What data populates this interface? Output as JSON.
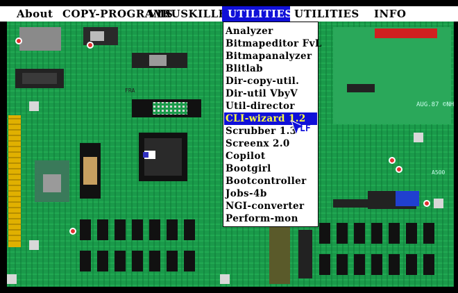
{
  "menubar": {
    "items": [
      {
        "label": "About"
      },
      {
        "label": "COPY-PROGRAMS"
      },
      {
        "label": "VIRUSKILLERS"
      },
      {
        "label": "UTILITIES"
      },
      {
        "label": "UTILITIES"
      },
      {
        "label": "INFO"
      }
    ],
    "active_index": 3
  },
  "dropdown": {
    "items": [
      {
        "label": "Analyzer"
      },
      {
        "label": "Bitmapeditor FvL"
      },
      {
        "label": "Bitmapanalyzer"
      },
      {
        "label": "Blitlab"
      },
      {
        "label": "Dir-copy-util."
      },
      {
        "label": "Dir-util VbyV"
      },
      {
        "label": "Util-director"
      },
      {
        "label": "CLI-wizard 1.2"
      },
      {
        "label": "Scrubber 1.3"
      },
      {
        "label": "Screenx 2.0"
      },
      {
        "label": "Copilot"
      },
      {
        "label": "Bootgirl"
      },
      {
        "label": "Bootcontroller"
      },
      {
        "label": "Jobs-4b"
      },
      {
        "label": "NGI-converter"
      },
      {
        "label": "Perform-mon"
      }
    ],
    "selected_index": 7
  },
  "board_labels": {
    "copyright_block": "AUG.87 ©NH",
    "board_model": "A500",
    "cursor_label": "LF",
    "chip_label": "FRA"
  },
  "colors": {
    "board": "#1a9a4a",
    "menubar": "#ffffff",
    "highlight": "#1010d8",
    "highlight_text": "#ffff40"
  }
}
